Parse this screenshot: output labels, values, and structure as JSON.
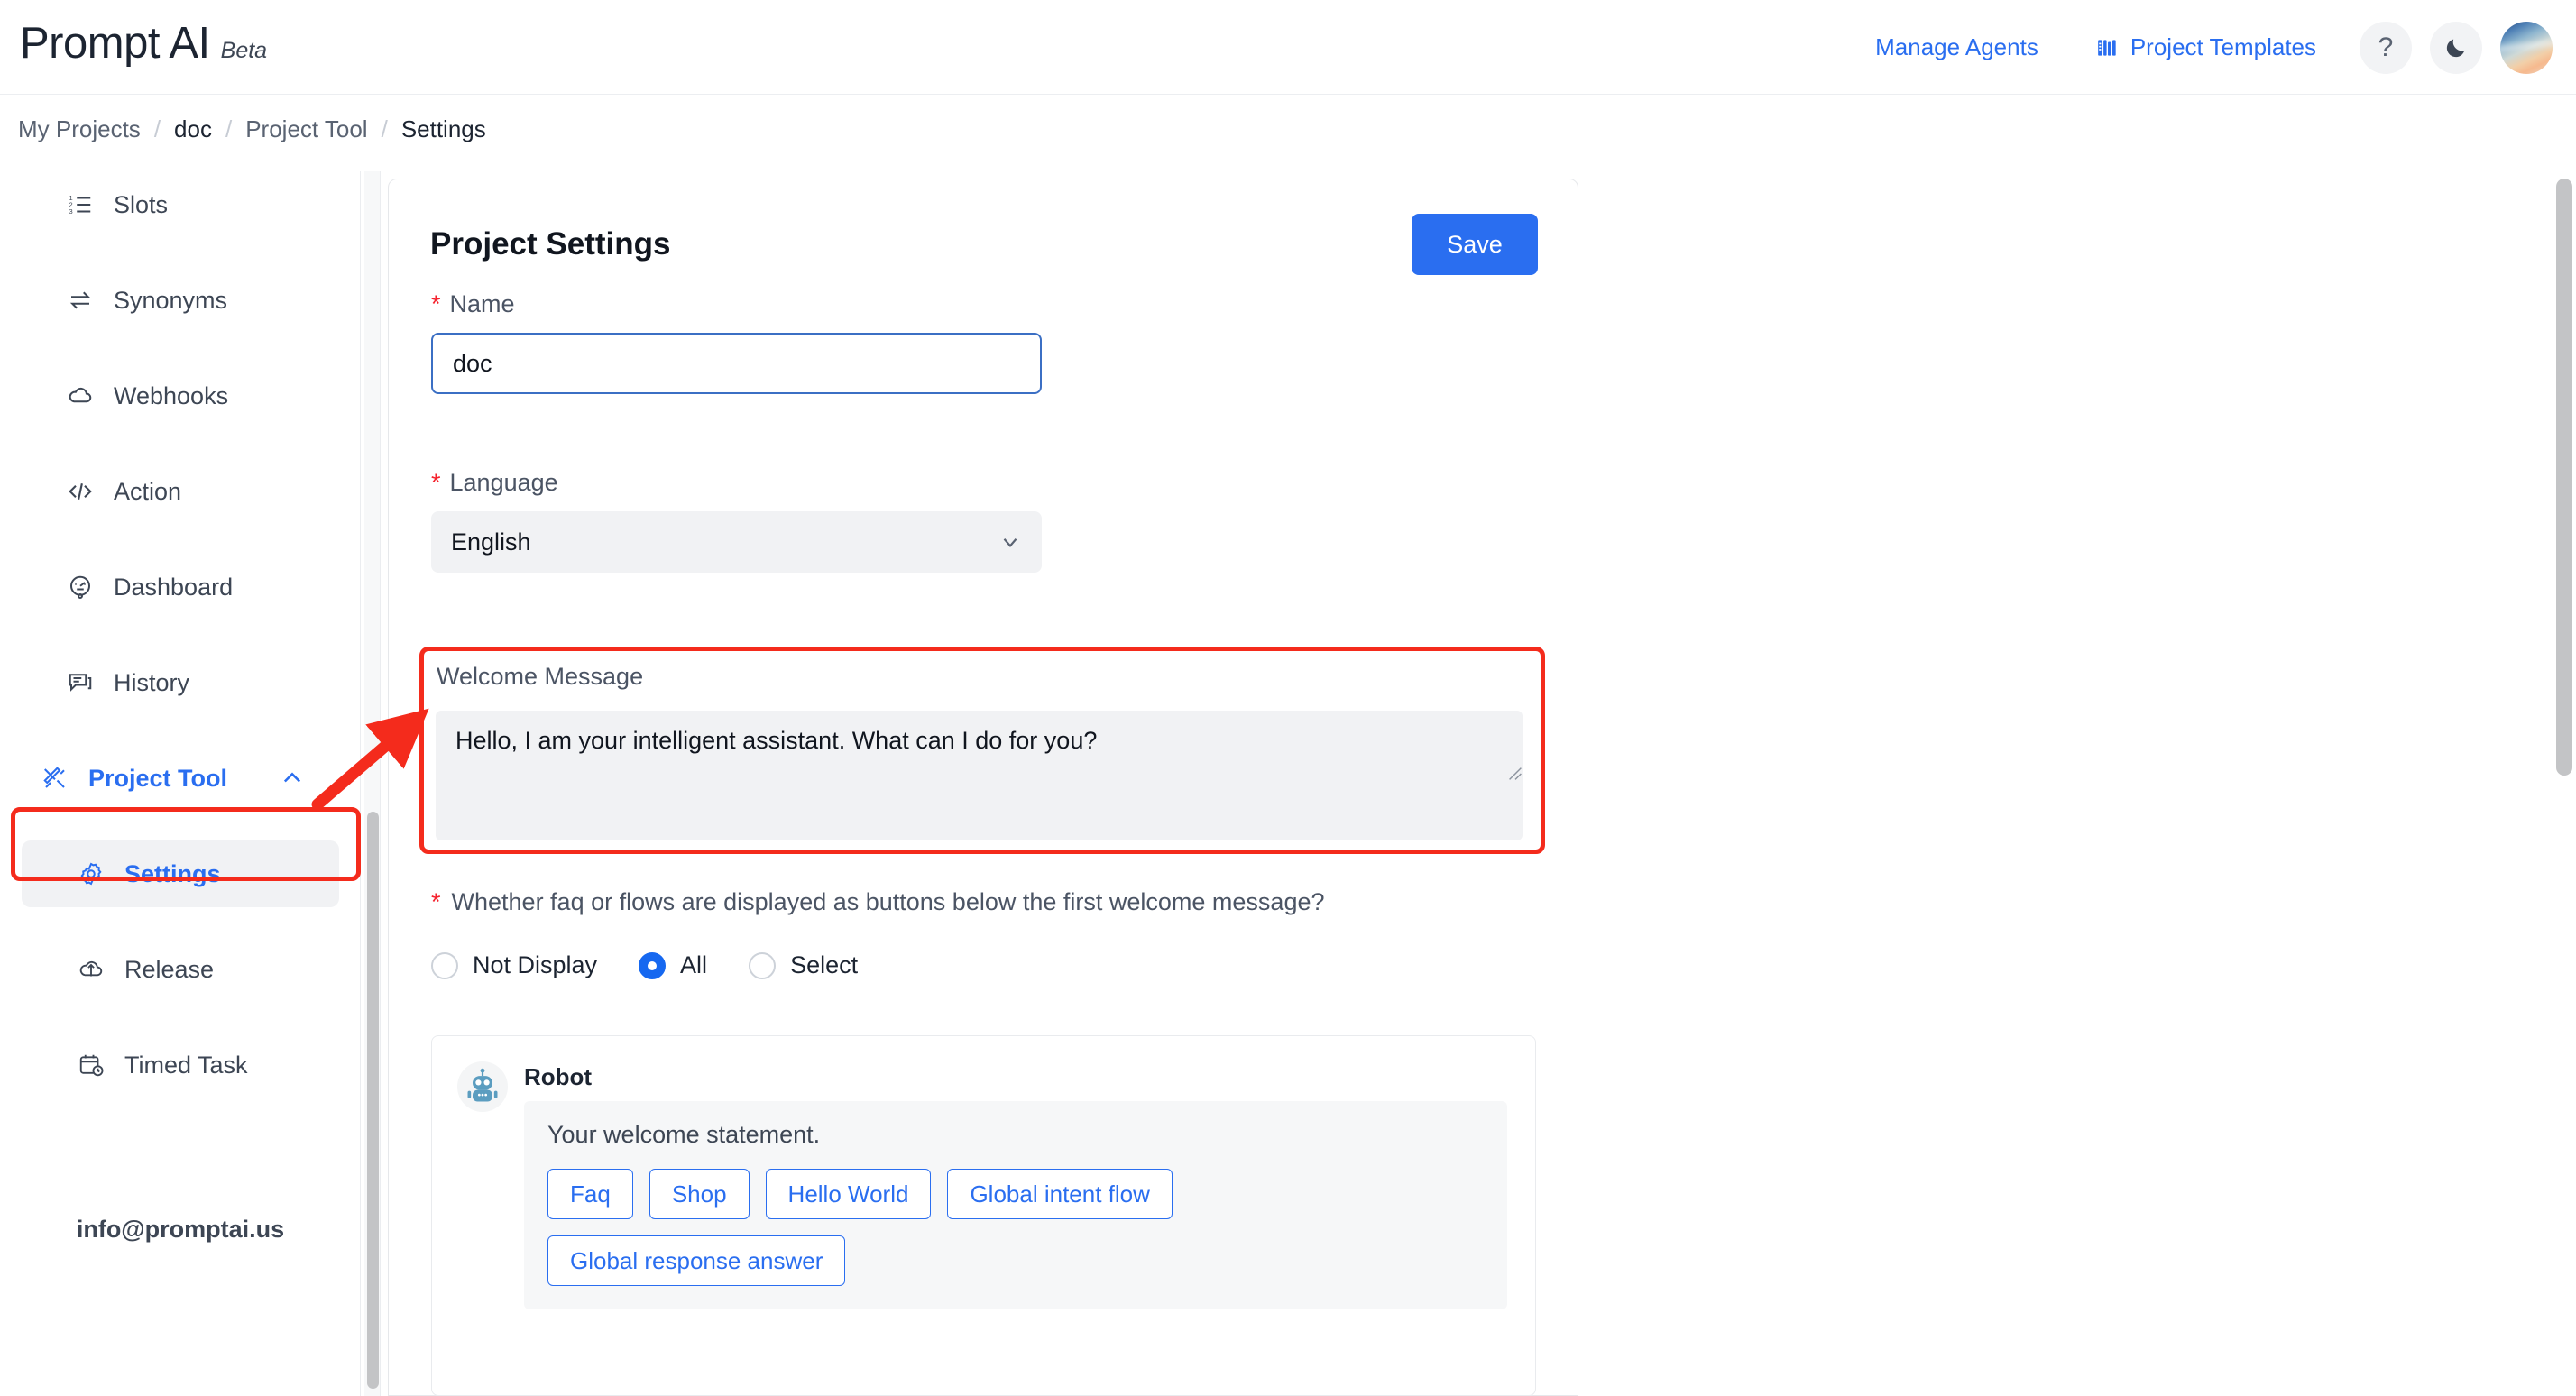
{
  "header": {
    "brand_name": "Prompt AI",
    "brand_beta": "Beta",
    "manage_agents": "Manage Agents",
    "project_templates": "Project Templates",
    "help_glyph": "?",
    "icons": {
      "books": "books-icon",
      "help": "help-icon",
      "dark_mode": "moon-icon",
      "avatar": "user-avatar"
    },
    "accent_color": "#2a6ef0"
  },
  "breadcrumb": {
    "separator": "/",
    "items": [
      {
        "label": "My Projects"
      },
      {
        "label": "doc"
      },
      {
        "label": "Project Tool"
      },
      {
        "label": "Settings"
      }
    ]
  },
  "sidebar": {
    "items": [
      {
        "label": "Slots",
        "icon": "ordered-list-icon"
      },
      {
        "label": "Synonyms",
        "icon": "swap-arrows-icon"
      },
      {
        "label": "Webhooks",
        "icon": "cloud-icon"
      },
      {
        "label": "Action",
        "icon": "code-icon"
      },
      {
        "label": "Dashboard",
        "icon": "dashboard-icon"
      },
      {
        "label": "History",
        "icon": "comment-icon"
      }
    ],
    "group": {
      "label": "Project Tool",
      "icon": "tools-icon"
    },
    "sub_items": [
      {
        "label": "Settings",
        "icon": "gear-icon",
        "selected": true
      },
      {
        "label": "Release",
        "icon": "cloud-upload-icon",
        "selected": false
      },
      {
        "label": "Timed Task",
        "icon": "calendar-clock-icon",
        "selected": false
      }
    ],
    "email": "info@promptai.us"
  },
  "main": {
    "title": "Project Settings",
    "save_label": "Save",
    "name_field": {
      "label": "Name",
      "required": true,
      "value": "doc"
    },
    "language_field": {
      "label": "Language",
      "required": true,
      "value": "English"
    },
    "welcome_field": {
      "label": "Welcome Message",
      "value": "Hello, I am your intelligent assistant. What can I do for you?"
    },
    "display_question": {
      "label": "Whether faq or flows are displayed as buttons below the first welcome message?",
      "required": true,
      "options": [
        {
          "label": "Not Display",
          "selected": false
        },
        {
          "label": "All",
          "selected": true
        },
        {
          "label": "Select",
          "selected": false
        }
      ]
    },
    "preview": {
      "bot_name": "Robot",
      "bot_icon": "robot-avatar-icon",
      "message": "Your welcome statement.",
      "chips": [
        "Faq",
        "Shop",
        "Hello World",
        "Global intent flow",
        "Global response answer"
      ]
    }
  },
  "annotations": {
    "highlight_color": "#f42b1c",
    "arrow": "red-arrow-pointing-to-welcome-message",
    "boxes": [
      "settings-sidebar-item",
      "welcome-message-field"
    ]
  }
}
